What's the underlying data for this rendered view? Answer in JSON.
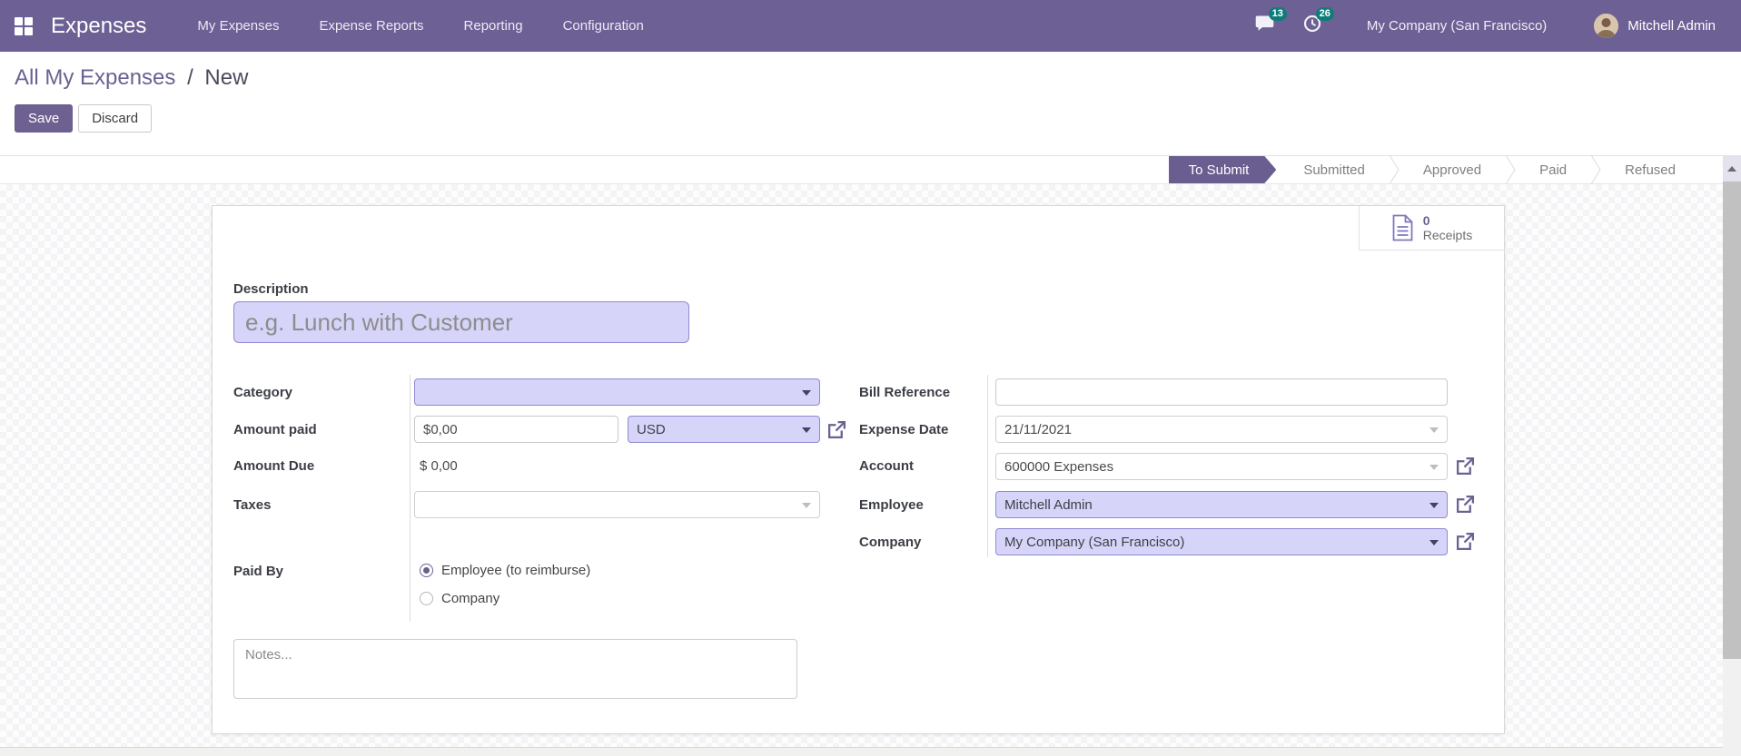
{
  "colors": {
    "primary_purple": "#6c6094",
    "active_stage_purple": "#6a5e90",
    "lavender_field_bg": "#d6d4f8",
    "lavender_field_border": "#8f8ad0",
    "badge_teal": "#0e7d7a"
  },
  "navbar": {
    "brand": "Expenses",
    "menu": [
      {
        "label": "My Expenses"
      },
      {
        "label": "Expense Reports"
      },
      {
        "label": "Reporting"
      },
      {
        "label": "Configuration"
      }
    ],
    "messages_count": "13",
    "activities_count": "26",
    "company": "My Company (San Francisco)",
    "user": "Mitchell Admin"
  },
  "breadcrumb": {
    "parent": "All My Expenses",
    "separator": "/",
    "current": "New"
  },
  "actions": {
    "save": "Save",
    "discard": "Discard"
  },
  "statusbar": {
    "stages": [
      {
        "label": "To Submit",
        "active": true
      },
      {
        "label": "Submitted",
        "active": false
      },
      {
        "label": "Approved",
        "active": false
      },
      {
        "label": "Paid",
        "active": false
      },
      {
        "label": "Refused",
        "active": false
      }
    ]
  },
  "sheet": {
    "receipts": {
      "count": "0",
      "label": "Receipts"
    },
    "description": {
      "label": "Description",
      "placeholder": "e.g. Lunch with Customer"
    },
    "category": {
      "label": "Category",
      "value": ""
    },
    "amount_paid": {
      "label": "Amount paid",
      "value": "$0,00",
      "currency": "USD"
    },
    "amount_due": {
      "label": "Amount Due",
      "value": "$ 0,00"
    },
    "taxes": {
      "label": "Taxes",
      "value": ""
    },
    "bill_reference": {
      "label": "Bill Reference",
      "value": ""
    },
    "expense_date": {
      "label": "Expense Date",
      "value": "21/11/2021"
    },
    "account": {
      "label": "Account",
      "value": "600000 Expenses"
    },
    "employee": {
      "label": "Employee",
      "value": "Mitchell Admin"
    },
    "company": {
      "label": "Company",
      "value": "My Company (San Francisco)"
    },
    "paid_by": {
      "label": "Paid By",
      "options": [
        {
          "label": "Employee (to reimburse)",
          "selected": true
        },
        {
          "label": "Company",
          "selected": false
        }
      ]
    },
    "notes": {
      "placeholder": "Notes..."
    }
  }
}
